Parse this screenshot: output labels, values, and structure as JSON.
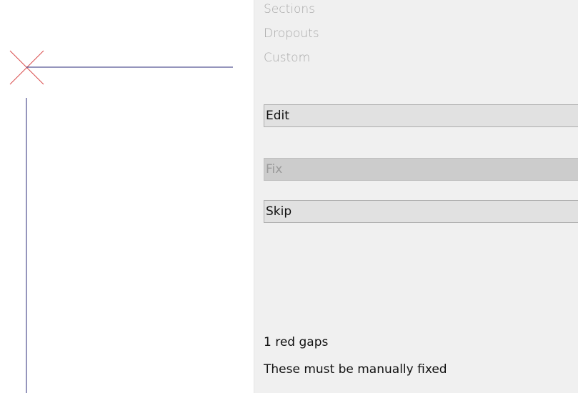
{
  "sections": {
    "items": [
      {
        "label": "Sections"
      },
      {
        "label": "Dropouts"
      },
      {
        "label": "Custom"
      }
    ]
  },
  "actions": {
    "edit_label": "Edit",
    "fix_label": "Fix",
    "skip_label": "Skip",
    "fix_disabled": true
  },
  "status": {
    "gap_count_text": "1 red gaps",
    "message": "These must be manually fixed"
  },
  "colors": {
    "line_color": "#2b2b7a",
    "marker_color": "#d94b4b",
    "panel_bg": "#f0f0f0",
    "button_bg": "#e1e1e1",
    "disabled_button_bg": "#cccccc"
  },
  "icons": {
    "gap_marker": "x-mark-icon"
  }
}
